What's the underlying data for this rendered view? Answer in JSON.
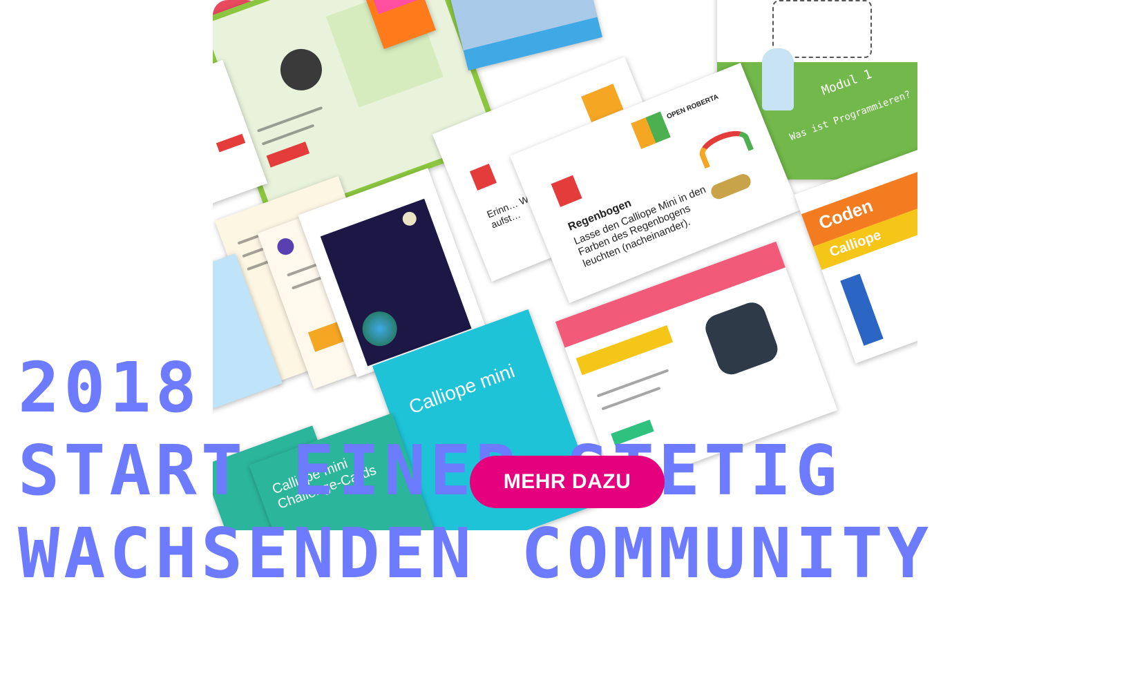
{
  "hero": {
    "headline_line1": "2018",
    "headline_line2": "START EINER STETIG",
    "headline_line3": "WACHSENDEN COMMUNITY",
    "cta_label": "MEHR DAZU",
    "headline_color": "#6c7bff",
    "cta_color": "#e5007d"
  },
  "collage": {
    "modul_card_title": "Modul 1",
    "modul_card_subtitle": "Was ist Programmieren?",
    "card_regenbogen_title": "Regenbogen",
    "card_regenbogen_text": "Lasse den Calliope Mini in den Farben des Regenbogens leuchten (nacheinander).",
    "card_erinnern_fragment": "Erinn… Wenn… aufst…",
    "card_challenge_title": "Calliope mini Challenge-Cards",
    "card_coden_title": "Coden",
    "card_coden_sub": "Calliope",
    "card_teal_title": "Calliope mini",
    "card_open_roberta_logo": "OPEN ROBERTA"
  }
}
